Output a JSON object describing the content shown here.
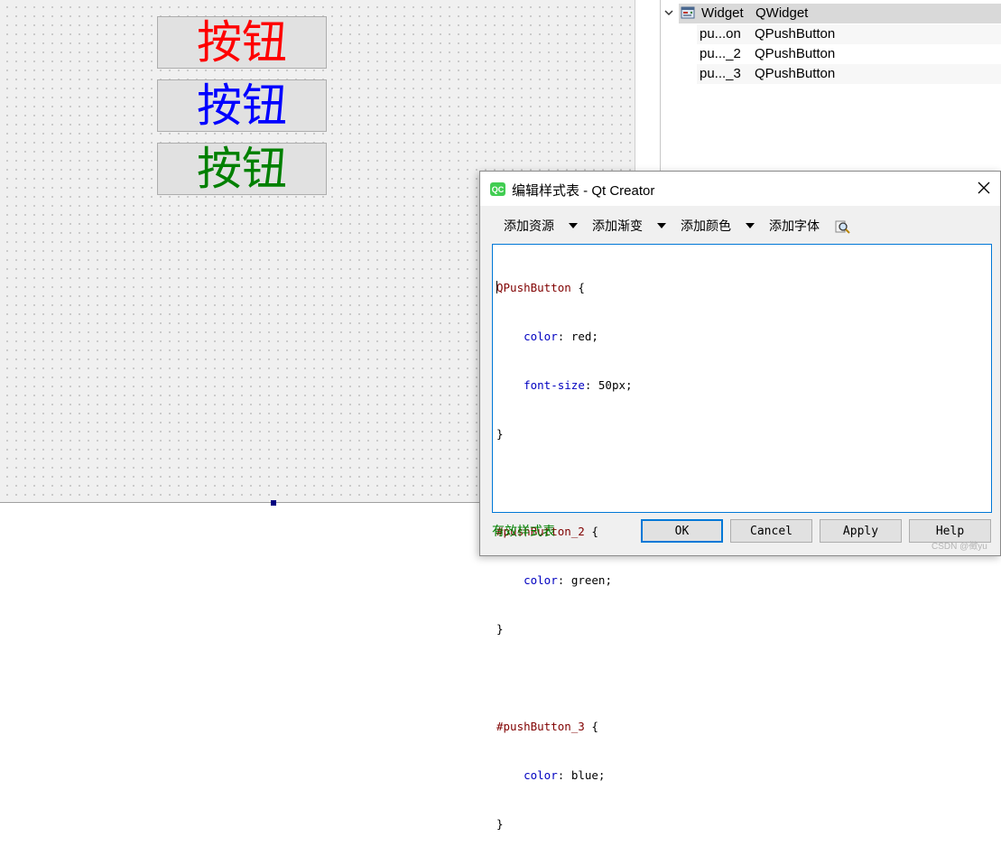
{
  "designer": {
    "buttons": [
      {
        "text": "按钮",
        "color": "#ff0000"
      },
      {
        "text": "按钮",
        "color": "#0000ff"
      },
      {
        "text": "按钮",
        "color": "#008000"
      }
    ]
  },
  "inspector": {
    "rows": [
      {
        "name": "Widget",
        "class": "QWidget"
      },
      {
        "name": "pu...on",
        "class": "QPushButton"
      },
      {
        "name": "pu..._2",
        "class": "QPushButton"
      },
      {
        "name": "pu..._3",
        "class": "QPushButton"
      }
    ]
  },
  "dialog": {
    "title": "编辑样式表 - Qt Creator",
    "app_icon_text": "QC",
    "toolbar": {
      "add_resource": "添加资源",
      "add_gradient": "添加渐变",
      "add_color": "添加颜色",
      "add_font": "添加字体"
    },
    "editor": {
      "lines": [
        {
          "selector": "QPushButton",
          "open": " {"
        },
        {
          "prop": "color",
          "value": "red"
        },
        {
          "prop": "font-size",
          "value": "50px"
        },
        {
          "close": "}"
        },
        {
          "blank": ""
        },
        {
          "selector": "#pushButton_2",
          "open": " {"
        },
        {
          "prop": "color",
          "value": "green"
        },
        {
          "close": "}"
        },
        {
          "blank": ""
        },
        {
          "selector": "#pushButton_3",
          "open": " {"
        },
        {
          "prop": "color",
          "value": "blue"
        },
        {
          "close": "}"
        }
      ]
    },
    "status": "有效样式表",
    "buttons": {
      "ok": "OK",
      "cancel": "Cancel",
      "apply": "Apply",
      "help": "Help"
    }
  },
  "watermark": "CSDN @徵yu",
  "colors": {
    "selector": "#800000",
    "property": "#0000c0",
    "valid_status": "#008000",
    "focus_border": "#0078d7"
  }
}
